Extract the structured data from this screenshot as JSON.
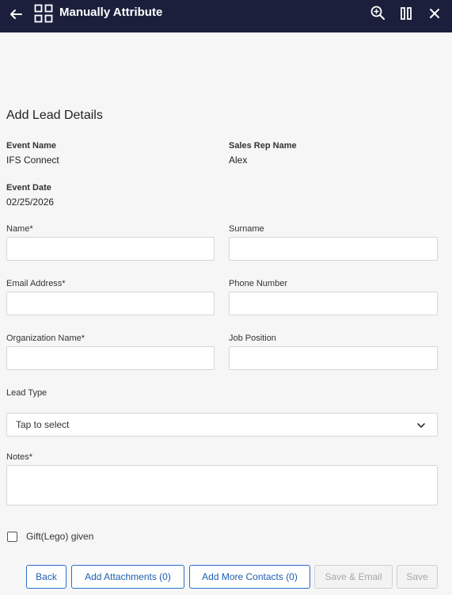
{
  "header": {
    "title": "Manually Attribute"
  },
  "form": {
    "heading": "Add Lead Details",
    "event_name_label": "Event Name",
    "event_name_value": "IFS Connect",
    "sales_rep_label": "Sales Rep Name",
    "sales_rep_value": "Alex",
    "event_date_label": "Event Date",
    "event_date_value": "02/25/2026",
    "name_label": "Name*",
    "surname_label": "Surname",
    "email_label": "Email Address*",
    "phone_label": "Phone Number",
    "org_label": "Organization Name*",
    "job_label": "Job Position",
    "lead_type_label": "Lead Type",
    "lead_type_placeholder": "Tap to select",
    "notes_label": "Notes*",
    "gift_label": "Gift(Lego) given",
    "gift_checked": false
  },
  "footer": {
    "back": "Back",
    "add_attachments": "Add Attachments (0)",
    "add_contacts": "Add More Contacts (0)",
    "save_email": "Save & Email",
    "save": "Save"
  }
}
